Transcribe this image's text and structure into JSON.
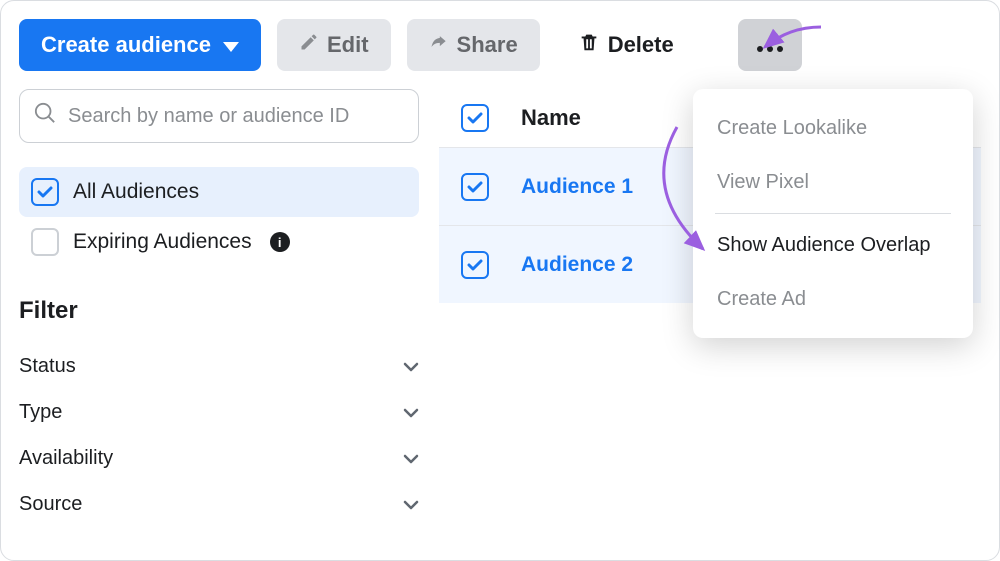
{
  "toolbar": {
    "create_label": "Create audience",
    "edit_label": "Edit",
    "share_label": "Share",
    "delete_label": "Delete"
  },
  "search": {
    "placeholder": "Search by name or audience ID"
  },
  "sidebar": {
    "items": [
      {
        "label": "All Audiences",
        "checked": true,
        "selected": true
      },
      {
        "label": "Expiring Audiences",
        "checked": false,
        "selected": false,
        "info": true
      }
    ],
    "filter_heading": "Filter",
    "filters": [
      {
        "label": "Status"
      },
      {
        "label": "Type"
      },
      {
        "label": "Availability"
      },
      {
        "label": "Source"
      }
    ]
  },
  "table": {
    "header_name": "Name",
    "rows": [
      {
        "name": "Audience 1",
        "checked": true
      },
      {
        "name": "Audience 2",
        "checked": true
      }
    ]
  },
  "dropdown": {
    "items": [
      {
        "label": "Create Lookalike",
        "enabled": false
      },
      {
        "label": "View Pixel",
        "enabled": false
      },
      {
        "label": "Show Audience Overlap",
        "enabled": true
      },
      {
        "label": "Create Ad",
        "enabled": false
      }
    ]
  },
  "icons": {
    "edit": "pencil-icon",
    "share": "share-arrow-icon",
    "delete": "trash-icon",
    "more": "dots-icon",
    "search": "search-icon",
    "chevron": "chevron-down-icon",
    "info": "info-icon"
  }
}
